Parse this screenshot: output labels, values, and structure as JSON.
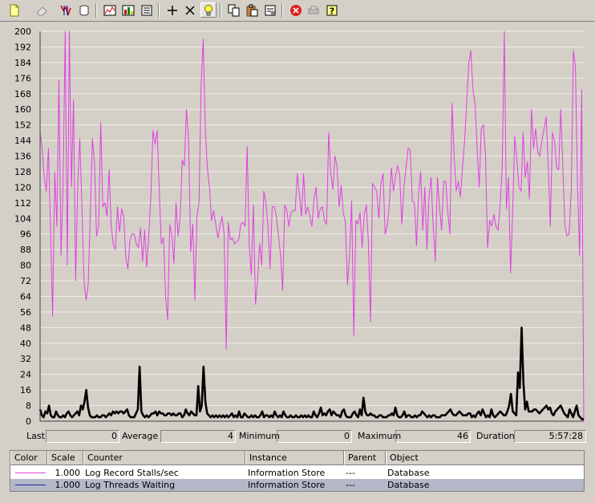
{
  "toolbar": {
    "buttons": [
      {
        "name": "new-counter-set-button",
        "icon": "new-document-icon",
        "active": false
      },
      {
        "name": "clear-display-button",
        "icon": "eraser-icon",
        "active": false
      },
      {
        "name": "view-current-activity-button",
        "icon": "activity-icon",
        "active": false
      },
      {
        "name": "view-log-data-button",
        "icon": "database-icon",
        "active": false
      },
      {
        "name": "view-graph-button",
        "icon": "graph-icon",
        "active": false
      },
      {
        "name": "view-histogram-button",
        "icon": "histogram-icon",
        "active": false
      },
      {
        "name": "view-report-button",
        "icon": "report-icon",
        "active": false
      },
      {
        "name": "add-counter-button",
        "icon": "plus-icon",
        "active": false
      },
      {
        "name": "delete-counter-button",
        "icon": "x-icon",
        "active": false
      },
      {
        "name": "highlight-button",
        "icon": "lightbulb-icon",
        "active": true
      },
      {
        "name": "copy-properties-button",
        "icon": "copy-icon",
        "active": false
      },
      {
        "name": "paste-counter-list-button",
        "icon": "paste-icon",
        "active": false
      },
      {
        "name": "properties-button",
        "icon": "properties-icon",
        "active": false
      },
      {
        "name": "freeze-display-button",
        "icon": "stop-icon",
        "active": false
      },
      {
        "name": "update-data-button",
        "icon": "update-icon",
        "active": false
      },
      {
        "name": "help-button",
        "icon": "help-icon",
        "active": false
      }
    ]
  },
  "chart_data": {
    "type": "line",
    "ylim": [
      0,
      200
    ],
    "yticks": [
      "200",
      "192",
      "184",
      "176",
      "168",
      "160",
      "152",
      "144",
      "136",
      "128",
      "120",
      "112",
      "104",
      "96",
      "88",
      "80",
      "72",
      "64",
      "56",
      "48",
      "40",
      "32",
      "24",
      "16",
      "8",
      "0"
    ],
    "grid": true,
    "series": [
      {
        "name": "Log Record Stalls/sec",
        "color": "#e040e0",
        "values": [
          148,
          140,
          125,
          118,
          140,
          100,
          54,
          128,
          100,
          175,
          85,
          122,
          200,
          80,
          200,
          120,
          165,
          72,
          120,
          145,
          110,
          72,
          62,
          70,
          106,
          145,
          133,
          95,
          100,
          153,
          110,
          112,
          105,
          129,
          100,
          91,
          88,
          110,
          97,
          109,
          105,
          84,
          78,
          93,
          96,
          96,
          91,
          89,
          99,
          82,
          98,
          79,
          96,
          116,
          149,
          142,
          149,
          118,
          91,
          94,
          64,
          52,
          101,
          95,
          81,
          112,
          95,
          105,
          134,
          131,
          160,
          145,
          87,
          101,
          62,
          105,
          112,
          172,
          196,
          150,
          130,
          120,
          103,
          108,
          101,
          94,
          100,
          105,
          96,
          37,
          102,
          93,
          94,
          91,
          92,
          93,
          101,
          102,
          100,
          141,
          90,
          75,
          111,
          60,
          72,
          91,
          80,
          118,
          112,
          100,
          78,
          110,
          110,
          105,
          95,
          85,
          67,
          111,
          108,
          100,
          107,
          108,
          108,
          127,
          116,
          105,
          127,
          106,
          110,
          105,
          100,
          114,
          120,
          104,
          109,
          110,
          103,
          101,
          148,
          127,
          119,
          136,
          131,
          110,
          121,
          107,
          102,
          70,
          85,
          113,
          44,
          103,
          101,
          107,
          89,
          106,
          111,
          92,
          51,
          122,
          120,
          118,
          104,
          122,
          127,
          96,
          100,
          111,
          130,
          118,
          126,
          131,
          126,
          101,
          120,
          130,
          140,
          139,
          113,
          112,
          90,
          117,
          128,
          98,
          120,
          88,
          115,
          125,
          100,
          82,
          125,
          110,
          98,
          123,
          123,
          107,
          96,
          163,
          136,
          118,
          123,
          115,
          130,
          144,
          164,
          184,
          190,
          170,
          163,
          140,
          120,
          150,
          152,
          137,
          89,
          103,
          100,
          106,
          100,
          98,
          111,
          131,
          200,
          109,
          125,
          76,
          107,
          146,
          134,
          120,
          118,
          148,
          125,
          133,
          114,
          160,
          140,
          150,
          138,
          136,
          144,
          150,
          156,
          131,
          100,
          148,
          144,
          130,
          129,
          160,
          130,
          100,
          95,
          96,
          118,
          190,
          182,
          120,
          85,
          170,
          0
        ]
      },
      {
        "name": "Log Threads Waiting",
        "color": "#000000",
        "values": [
          6,
          3,
          2,
          5,
          4,
          8,
          3,
          2,
          2,
          5,
          3,
          2,
          2,
          3,
          2,
          4,
          5,
          3,
          2,
          3,
          4,
          5,
          3,
          8,
          6,
          10,
          16,
          7,
          3,
          2,
          2,
          2,
          3,
          2,
          2,
          3,
          3,
          2,
          3,
          4,
          3,
          5,
          4,
          5,
          4,
          5,
          5,
          4,
          5,
          6,
          3,
          2,
          2,
          2,
          4,
          6,
          28,
          5,
          3,
          2,
          3,
          2,
          3,
          4,
          4,
          5,
          3,
          5,
          4,
          4,
          3,
          3,
          4,
          4,
          3,
          4,
          3,
          3,
          4,
          4,
          2,
          3,
          6,
          4,
          3,
          5,
          4,
          3,
          3,
          18,
          5,
          8,
          28,
          10,
          4,
          3,
          2,
          3,
          2,
          3,
          2,
          3,
          2,
          3,
          2,
          3,
          2,
          3,
          4,
          2,
          3,
          2,
          5,
          2,
          2,
          4,
          3,
          2,
          2,
          3,
          2,
          3,
          2,
          2,
          3,
          5,
          2,
          3,
          3,
          2,
          3,
          2,
          5,
          3,
          2,
          3,
          2,
          5,
          3,
          2,
          2,
          3,
          2,
          2,
          3,
          2,
          2,
          3,
          2,
          3,
          2,
          3,
          2,
          2,
          5,
          3,
          2,
          4,
          7,
          3,
          4,
          3,
          5,
          6,
          3,
          5,
          4,
          3,
          3,
          2,
          5,
          6,
          3,
          2,
          2,
          2,
          4,
          5,
          3,
          2,
          6,
          3,
          12,
          5,
          3,
          3,
          4,
          3,
          3,
          2,
          2,
          3,
          3,
          2,
          2,
          2,
          3,
          3,
          4,
          3,
          7,
          3,
          2,
          2,
          3,
          5,
          2,
          3,
          3,
          2,
          2,
          3,
          2,
          3,
          3,
          5,
          4,
          3,
          2,
          3,
          2,
          3,
          3,
          2,
          2,
          2,
          3,
          3,
          3,
          4,
          5,
          6,
          4,
          3,
          3,
          4,
          5,
          4,
          3,
          3,
          3,
          4,
          4,
          2,
          3,
          2,
          4,
          5,
          3,
          6,
          4,
          2,
          3,
          2,
          6,
          3,
          2,
          3,
          4,
          5,
          4,
          3,
          3,
          5,
          8,
          14,
          5,
          4,
          3,
          25,
          17,
          48,
          20,
          6,
          10,
          5,
          5,
          5,
          6,
          6,
          5,
          4,
          5,
          6,
          7,
          8,
          6,
          7,
          4,
          3,
          5,
          6,
          7,
          8,
          6,
          4,
          3,
          2,
          6,
          4,
          2,
          5,
          8,
          3,
          2,
          1,
          1
        ]
      }
    ]
  },
  "stats": {
    "last_label": "Last",
    "last_value": "0",
    "average_label": "Average",
    "average_value": "4",
    "minimum_label": "Minimum",
    "minimum_value": "0",
    "maximum_label": "Maximum",
    "maximum_value": "46",
    "duration_label": "Duration",
    "duration_value": "5:57:28"
  },
  "legend": {
    "headers": {
      "color": "Color",
      "scale": "Scale",
      "counter": "Counter",
      "instance": "Instance",
      "parent": "Parent",
      "object": "Object"
    },
    "rows": [
      {
        "color": "#e040e0",
        "scale": "1.000",
        "counter": "Log Record Stalls/sec",
        "instance": "Information Store",
        "parent": "---",
        "object": "Database",
        "selected": false
      },
      {
        "color": "#2020a0",
        "scale": "1.000",
        "counter": "Log Threads Waiting",
        "instance": "Information Store",
        "parent": "---",
        "object": "Database",
        "selected": true
      }
    ]
  }
}
